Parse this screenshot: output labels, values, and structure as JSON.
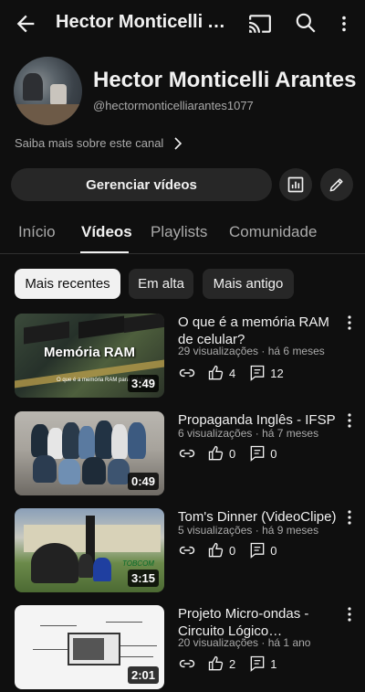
{
  "header": {
    "title": "Hector Monticelli Arantes",
    "icons": [
      "back-arrow-icon",
      "cast-icon",
      "search-icon",
      "more-vert-icon"
    ]
  },
  "channel": {
    "name": "Hector Monticelli Arantes",
    "handle": "@hectormonticelliarantes1077",
    "more_about": "Saiba mais sobre este canal",
    "manage_label": "Gerenciar vídeos"
  },
  "tabs": [
    {
      "label": "Início",
      "active": false
    },
    {
      "label": "Vídeos",
      "active": true
    },
    {
      "label": "Playlists",
      "active": false
    },
    {
      "label": "Comunidade",
      "active": false
    }
  ],
  "filters": [
    {
      "label": "Mais recentes",
      "active": true
    },
    {
      "label": "Em alta",
      "active": false
    },
    {
      "label": "Mais antigo",
      "active": false
    }
  ],
  "videos": [
    {
      "title": "O que é a memória RAM de celular?",
      "views": "29 visualizações",
      "age": "há 6 meses",
      "likes": "4",
      "comments": "12",
      "duration": "3:49",
      "thumb_text": "Memória RAM",
      "thumb_sub": "O que é a memória RAM para celulares"
    },
    {
      "title": "Propaganda Inglês - IFSP",
      "views": "6 visualizações",
      "age": "há 7 meses",
      "likes": "0",
      "comments": "0",
      "duration": "0:49"
    },
    {
      "title": "Tom's Dinner (VideoClipe)",
      "views": "5 visualizações",
      "age": "há 9 meses",
      "likes": "0",
      "comments": "0",
      "duration": "3:15",
      "thumb_text": "TOBCOM"
    },
    {
      "title": "Projeto Micro-ondas - Circuito Lógico (Eletrônic…",
      "views": "20 visualizações",
      "age": "há 1 ano",
      "likes": "2",
      "comments": "1",
      "duration": "2:01"
    }
  ],
  "meta_separator": "·",
  "colors": {
    "background": "#0f0f0f",
    "surface": "#272727",
    "text_primary": "#f1f1f1",
    "text_secondary": "#aaaaaa"
  }
}
